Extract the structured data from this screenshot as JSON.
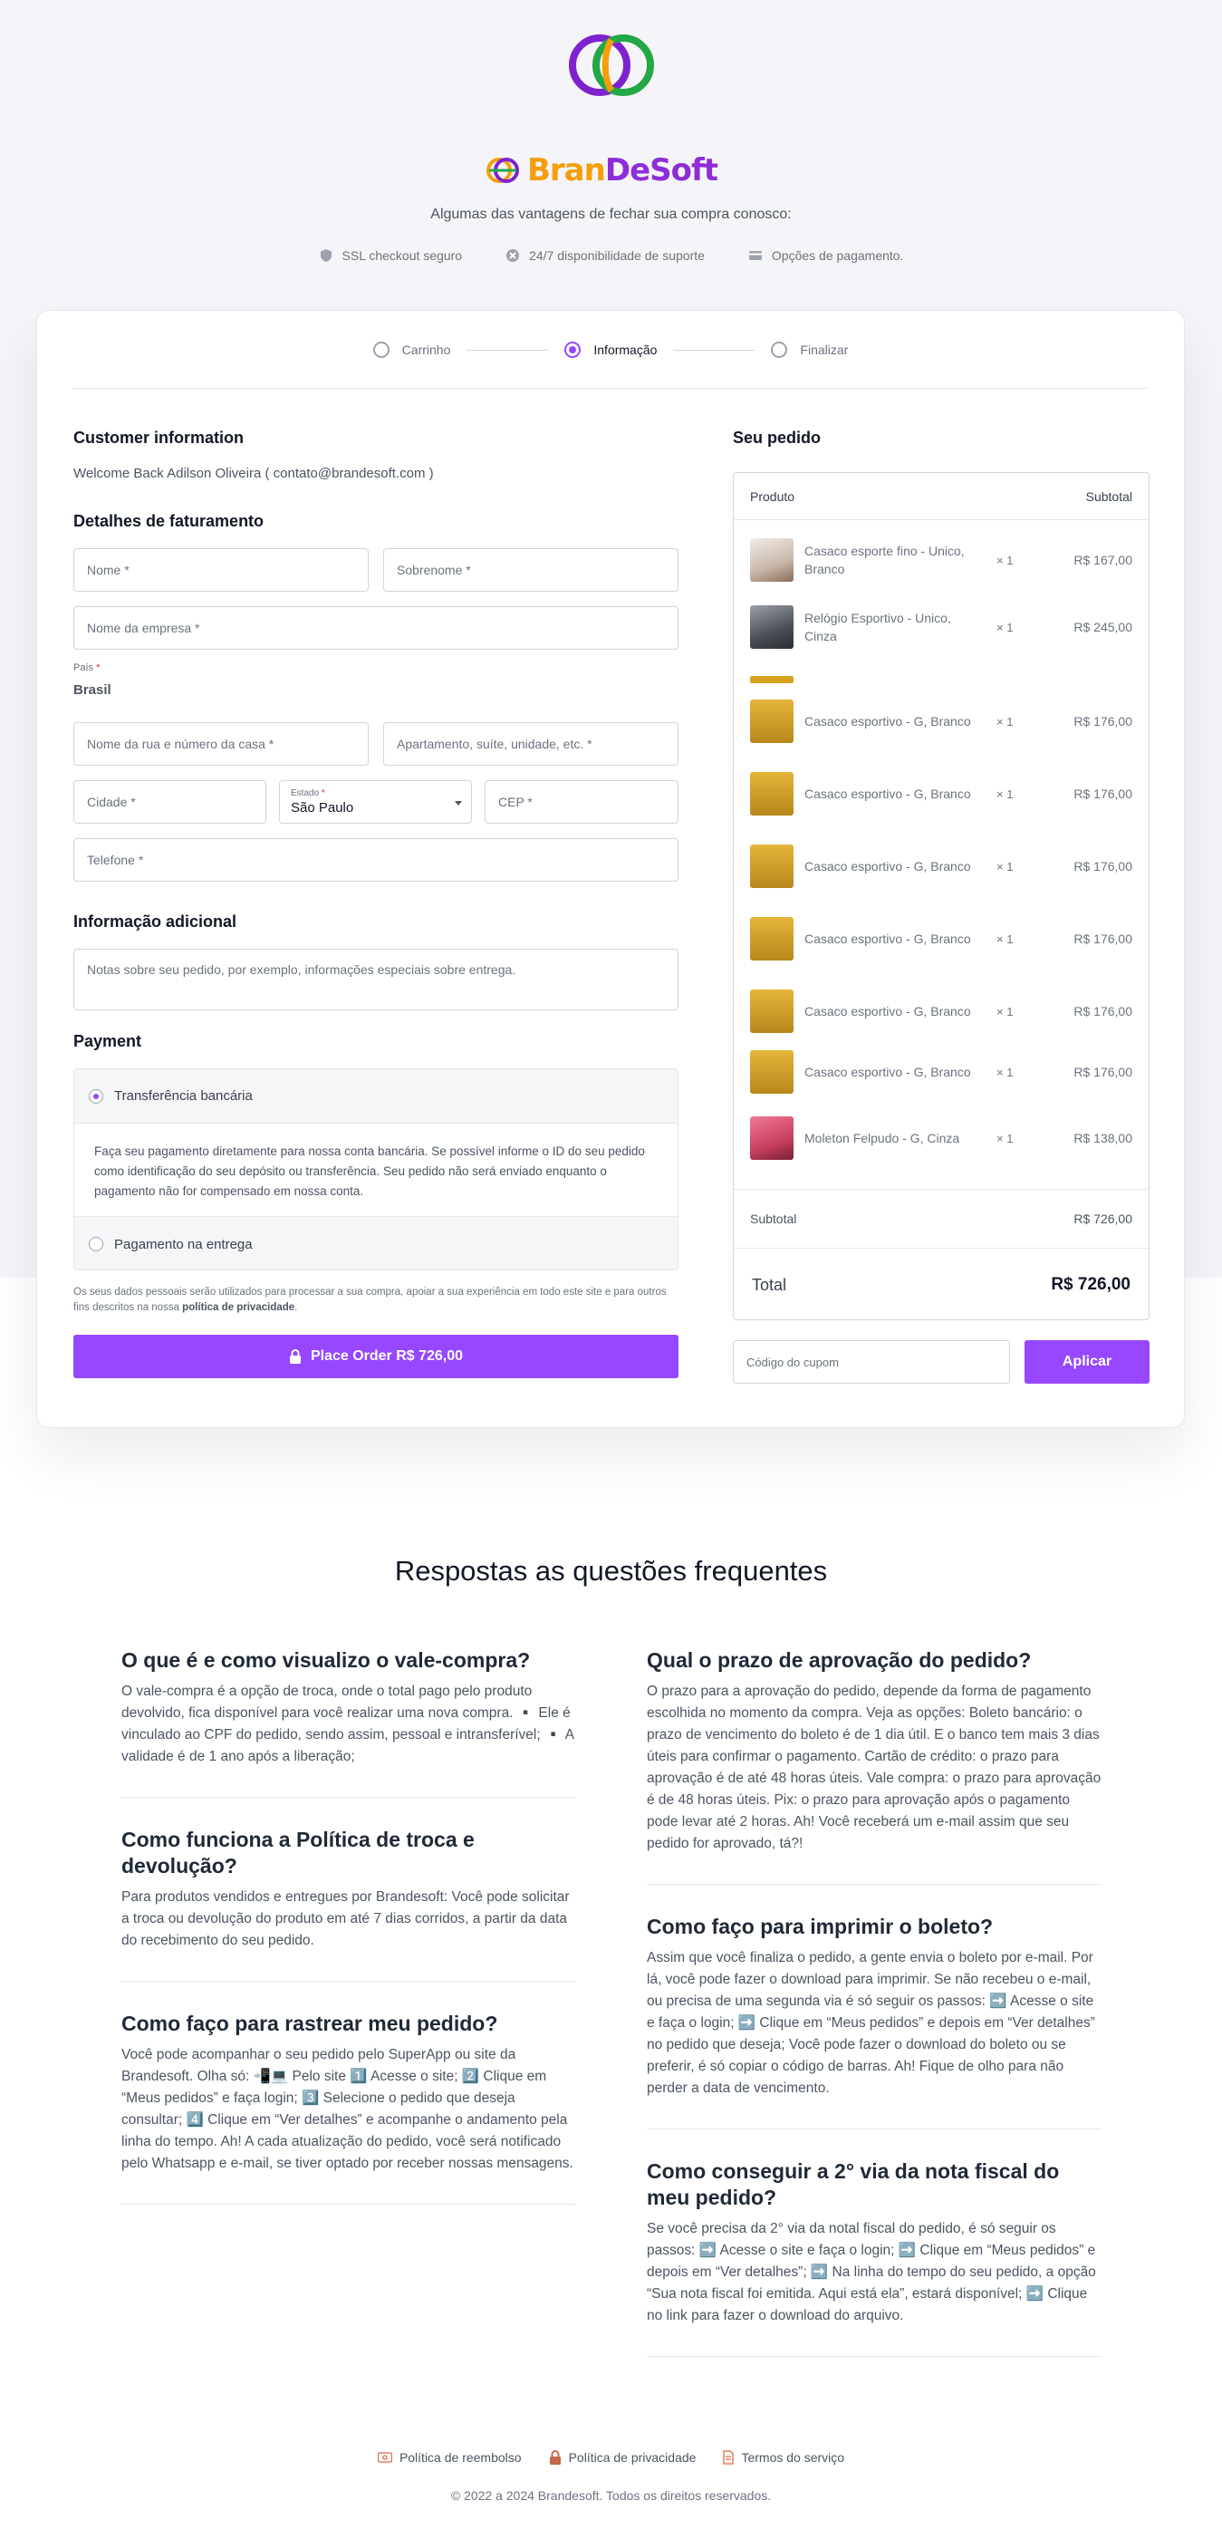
{
  "brand": {
    "name_part1": "Bran",
    "name_part2": "DeSoft"
  },
  "header": {
    "tagline": "Algumas das vantagens de fechar sua compra conosco:",
    "perks": [
      {
        "icon": "shield-icon",
        "label": "SSL checkout seguro"
      },
      {
        "icon": "support-icon",
        "label": "24/7 disponibilidade de suporte"
      },
      {
        "icon": "card-icon",
        "label": "Opções de pagamento."
      }
    ]
  },
  "steps": [
    {
      "label": "Carrinho",
      "active": false
    },
    {
      "label": "Informação",
      "active": true
    },
    {
      "label": "Finalizar",
      "active": false
    }
  ],
  "customer": {
    "title": "Customer information",
    "welcome": "Welcome Back Adilson Oliveira ( contato@brandesoft.com )"
  },
  "billing": {
    "title": "Detalhes de faturamento",
    "first_name": "Nome *",
    "last_name": "Sobrenome *",
    "company": "Nome da empresa *",
    "country_label": "País",
    "country_req": "*",
    "country_value": "Brasil",
    "street": "Nome da rua e número da casa *",
    "apartment": "Apartamento, suíte, unidade, etc. *",
    "city": "Cidade *",
    "state_label": "Estado",
    "state_req": "*",
    "state_value": "São Paulo",
    "zip": "CEP *",
    "phone": "Telefone *"
  },
  "additional": {
    "title": "Informação adicional",
    "notes_placeholder": "Notas sobre seu pedido, por exemplo, informações especiais sobre entrega."
  },
  "payment": {
    "title": "Payment",
    "option1": "Transferência bancária",
    "option1_desc": "Faça seu pagamento diretamente para nossa conta bancária. Se possível informe o ID do seu pedido como identificação do seu depósito ou transferência. Seu pedido não será enviado enquanto o pagamento não for compensado em nossa conta.",
    "option2": "Pagamento na entrega",
    "privacy_prefix": "Os seus dados pessoais serão utilizados para processar a sua compra, apoiar a sua experiência em todo este site e para outros fins descritos na nossa ",
    "privacy_link": "política de privacidade",
    "privacy_suffix": ".",
    "place_order": "Place Order  R$ 726,00"
  },
  "order": {
    "title": "Seu pedido",
    "col_product": "Produto",
    "col_subtotal": "Subtotal",
    "items": [
      {
        "name": "Casaco esporte fino - Unico, Branco",
        "qty": "× 1",
        "price": "R$ 167,00",
        "thumb": "#d9cfc6"
      },
      {
        "name": "Relógio Esportivo - Unico, Cinza",
        "qty": "× 1",
        "price": "R$ 245,00",
        "thumb": "#6b7075"
      },
      {
        "name": "Casaco esportivo - G, Branco",
        "qty": "× 1",
        "price": "R$ 176,00",
        "thumb": "#c99a2e"
      },
      {
        "name": "Casaco esportivo - G, Branco",
        "qty": "× 1",
        "price": "R$ 176,00",
        "thumb": "#c99a2e"
      },
      {
        "name": "Casaco esportivo - G, Branco",
        "qty": "× 1",
        "price": "R$ 176,00",
        "thumb": "#c99a2e"
      },
      {
        "name": "Casaco esportivo - G, Branco",
        "qty": "× 1",
        "price": "R$ 176,00",
        "thumb": "#c99a2e"
      },
      {
        "name": "Casaco esportivo - G, Branco",
        "qty": "× 1",
        "price": "R$ 176,00",
        "thumb": "#c99a2e"
      },
      {
        "name": "Casaco esportivo - G, Branco",
        "qty": "× 1",
        "price": "R$ 176,00",
        "thumb": "#c99a2e"
      },
      {
        "name": "Moleton Felpudo - G, Cinza",
        "qty": "× 1",
        "price": "R$ 138,00",
        "thumb": "#c9405f"
      }
    ],
    "subtotal_label": "Subtotal",
    "subtotal_value": "R$ 726,00",
    "total_label": "Total",
    "total_value": "R$ 726,00",
    "coupon_placeholder": "Código do cupom",
    "apply_label": "Aplicar"
  },
  "faq": {
    "title": "Respostas as questões frequentes",
    "left": [
      {
        "q": "O que é e como visualizo o vale-compra?",
        "a": "O vale-compra é a opção de troca, onde o total pago pelo produto devolvido, fica disponível para você realizar uma nova compra. ▪️ Ele é vinculado ao CPF do pedido, sendo assim, pessoal e intransferível; ▪️ A validade é de 1 ano após a liberação;"
      },
      {
        "q": "Como funciona a Política de troca e devolução?",
        "a": "Para produtos vendidos e entregues por Brandesoft: Você pode solicitar a troca ou devolução do produto em até 7 dias corridos, a partir da data do recebimento do seu pedido."
      },
      {
        "q": "Como faço para rastrear meu pedido?",
        "a": "Você pode acompanhar o seu pedido pelo SuperApp ou site da Brandesoft. Olha só: 📲💻 Pelo site 1️⃣ Acesse o site; 2️⃣ Clique em “Meus pedidos” e faça login; 3️⃣ Selecione o pedido que deseja consultar; 4️⃣ Clique em “Ver detalhes” e acompanhe o andamento pela linha do tempo. Ah! A cada atualização do pedido, você será notificado pelo Whatsapp e e-mail, se tiver optado por receber nossas mensagens."
      }
    ],
    "right": [
      {
        "q": "Qual o prazo de aprovação do pedido?",
        "a": "O prazo para a aprovação do pedido, depende da forma de pagamento escolhida no momento da compra. Veja as opções: Boleto bancário: o prazo de vencimento do boleto é de 1 dia útil. E o banco tem mais 3 dias úteis para confirmar o pagamento. Cartão de crédito: o prazo para aprovação é de até 48 horas úteis. Vale compra: o prazo para aprovação é de 48 horas úteis. Pix: o prazo para aprovação após o pagamento pode levar até 2 horas. Ah! Você receberá um e-mail assim que seu pedido for aprovado, tá?!"
      },
      {
        "q": "Como faço para imprimir o boleto?",
        "a": "Assim que você finaliza o pedido, a gente envia o boleto por e-mail. Por lá, você pode fazer o download para imprimir. Se não recebeu o e-mail, ou precisa de uma segunda via é só seguir os passos: ➡️ Acesse o site e faça o login; ➡️ Clique em “Meus pedidos” e depois em “Ver detalhes” no pedido que deseja; Você pode fazer o download do boleto ou se preferir, é só copiar o código de barras. Ah! Fique de olho para não perder a data de vencimento."
      },
      {
        "q": "Como conseguir a 2° via da nota fiscal do meu pedido?",
        "a": "Se você precisa da 2° via da notal fiscal do pedido, é só seguir os passos: ➡️ Acesse o site e faça o login; ➡️ Clique em “Meus pedidos” e depois em “Ver detalhes”; ➡️ Na linha do tempo do seu pedido, a opção “Sua nota fiscal foi emitida. Aqui está ela”, estará disponível; ➡️ Clique no link para fazer o download do arquivo."
      }
    ]
  },
  "footer": {
    "links": [
      {
        "icon": "refund-icon",
        "label": "Política de reembolso"
      },
      {
        "icon": "lock-icon",
        "label": "Política de privacidade"
      },
      {
        "icon": "document-icon",
        "label": "Termos do serviço"
      }
    ],
    "copyright": "© 2022 a 2024 Brandesoft. Todos os direitos reservados."
  },
  "colors": {
    "accent": "#9747ff",
    "brand_orange": "#f59e0b",
    "brand_purple": "#8e2dd6",
    "brand_green": "#22a845"
  }
}
